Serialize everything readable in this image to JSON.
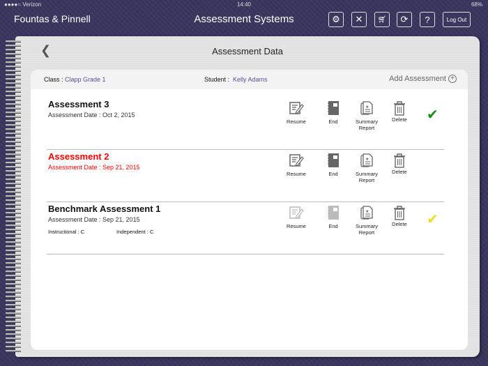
{
  "status": {
    "carrier": "●●●●○ Verizon",
    "time": "14:40",
    "battery": "68%"
  },
  "header": {
    "brand": "Fountas & Pinnell",
    "title": "Assessment Systems",
    "logout": "Log Out",
    "help": "?"
  },
  "page": {
    "title": "Assessment Data",
    "class_label": "Class :",
    "class_value": "Clapp Grade 1",
    "student_label": "Student :",
    "student_value": "Kelly Adams",
    "add": "Add Assessment"
  },
  "actions": {
    "resume": "Resume",
    "end": "End",
    "summary1": "Summary",
    "summary2": "Report",
    "delete": "Delete"
  },
  "assessments": [
    {
      "title": "Assessment 3",
      "date": "Assessment Date : Oct 2, 2015",
      "check": "#1a8a1a"
    },
    {
      "title": "Assessment 2",
      "date": "Assessment Date : Sep 21, 2015"
    },
    {
      "title": "Benchmark Assessment 1",
      "date": "Assessment Date : Sep 21, 2015",
      "instructional": "Instructional : C",
      "independent": "Independent : C",
      "check": "#e8e020"
    }
  ]
}
